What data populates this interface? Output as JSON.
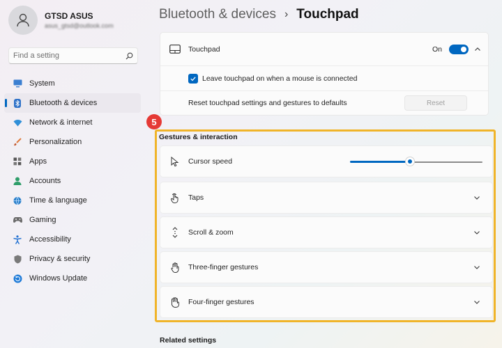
{
  "profile": {
    "name": "GTSD ASUS",
    "email": "asus_gtsd@outlook.com"
  },
  "search": {
    "placeholder": "Find a setting"
  },
  "sidebar": {
    "items": [
      {
        "label": "System",
        "icon": "monitor-icon"
      },
      {
        "label": "Bluetooth & devices",
        "icon": "bluetooth-icon",
        "active": true
      },
      {
        "label": "Network & internet",
        "icon": "wifi-icon"
      },
      {
        "label": "Personalization",
        "icon": "brush-icon"
      },
      {
        "label": "Apps",
        "icon": "apps-icon"
      },
      {
        "label": "Accounts",
        "icon": "accounts-icon"
      },
      {
        "label": "Time & language",
        "icon": "globe-clock-icon"
      },
      {
        "label": "Gaming",
        "icon": "gamepad-icon"
      },
      {
        "label": "Accessibility",
        "icon": "accessibility-icon"
      },
      {
        "label": "Privacy & security",
        "icon": "shield-icon"
      },
      {
        "label": "Windows Update",
        "icon": "update-icon"
      }
    ]
  },
  "breadcrumb": {
    "parent": "Bluetooth & devices",
    "separator": "›",
    "current": "Touchpad"
  },
  "touchpad": {
    "label": "Touchpad",
    "state": "On",
    "enabled": true,
    "leave_on_label": "Leave touchpad on when a mouse is connected",
    "leave_on_checked": true,
    "reset_label": "Reset touchpad settings and gestures to defaults",
    "reset_button": "Reset"
  },
  "step_badge": "5",
  "gestures": {
    "title": "Gestures & interaction",
    "cursor_speed": {
      "label": "Cursor speed",
      "value": 0.45
    },
    "items": [
      {
        "label": "Taps",
        "icon": "tap-icon"
      },
      {
        "label": "Scroll & zoom",
        "icon": "scroll-icon"
      },
      {
        "label": "Three-finger gestures",
        "icon": "three-finger-icon"
      },
      {
        "label": "Four-finger gestures",
        "icon": "four-finger-icon"
      }
    ]
  },
  "related": {
    "title": "Related settings"
  },
  "colors": {
    "accent": "#0067c0",
    "highlight": "#f0b429",
    "badge": "#e53935"
  }
}
